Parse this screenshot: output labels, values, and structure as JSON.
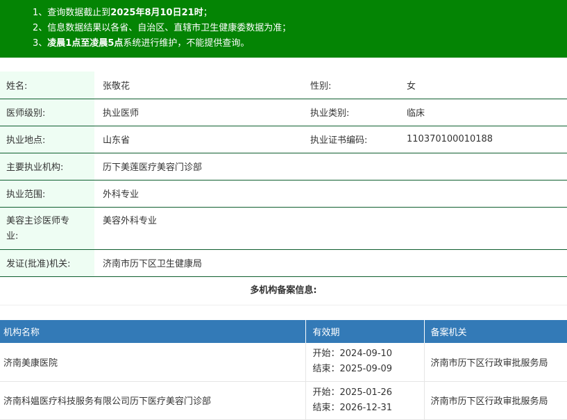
{
  "notice": {
    "line1_prefix": "1、查询数据截止到",
    "line1_bold": "2025年8月10日21时",
    "line1_suffix": "；",
    "line2": "2、信息数据结果以各省、自治区、直辖市卫生健康委数据为准；",
    "line3_prefix": "3、",
    "line3_bold": "凌晨1点至凌晨5点",
    "line3_suffix": "系统进行维护，不能提供查询。"
  },
  "doctor": {
    "name_label": "姓名:",
    "name": "张敬花",
    "gender_label": "性别:",
    "gender": "女",
    "level_label": "医师级别:",
    "level": "执业医师",
    "category_label": "执业类别:",
    "category": "临床",
    "location_label": "执业地点:",
    "location": "山东省",
    "cert_label": "执业证书编码:",
    "cert_no": "110370100010188",
    "institution_label": "主要执业机构:",
    "institution": "历下美莲医疗美容门诊部",
    "scope_label": "执业范围:",
    "scope": "外科专业",
    "cosmetic_label_1": "美容主诊医师专",
    "cosmetic_label_2": "业:",
    "cosmetic": "美容外科专业",
    "issuer_label": "发证(批准)机关:",
    "issuer": "济南市历下区卫生健康局"
  },
  "multi_title": "多机构备案信息:",
  "org_table": {
    "headers": [
      "机构名称",
      "有效期",
      "备案机关"
    ],
    "rows": [
      {
        "name": "济南美康医院",
        "start": "开始：2024-09-10",
        "end": "结束：2025-09-09",
        "authority": "济南市历下区行政审批服务局"
      },
      {
        "name": "济南科媪医疗科技服务有限公司历下医疗美容门诊部",
        "start": "开始：2025-01-26",
        "end": "结束：2026-12-31",
        "authority": "济南市历下区行政审批服务局"
      }
    ]
  },
  "colors": {
    "notice_bg": "#048404",
    "label_bg": "#eefdf3",
    "header_bg": "#337ab7",
    "row_border": "#0d5d2d"
  }
}
